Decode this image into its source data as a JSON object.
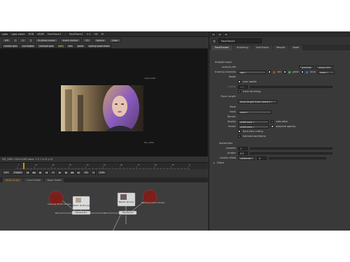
{
  "viewer": {
    "menubar": [
      "rgba",
      "rgba.alpha",
      "RGB",
      "sRGB",
      "FaceTrack1",
      "FaceTrack1"
    ],
    "menubar_extra": [
      "1:1",
      "2D",
      "M"
    ],
    "toolbar1": [
      "f/8",
      "1",
      "Surface mask",
      "track radius",
      "13",
      "ignore",
      "clear"
    ],
    "toolbar2_chips": [
      "center geo",
      "curvegeo",
      "remove geo",
      "pin",
      "set",
      "pose",
      "spring pose track"
    ],
    "frame_marks": [
      "1920,1080",
      "HD_1080"
    ],
    "status": "HD_1080 1920x1080  bbox: 0 0 1  x=0 y=0",
    "timeline_labels": [
      "1",
      "10",
      "20",
      "30",
      "40",
      "50",
      "60",
      "70",
      "80",
      "90",
      "100"
    ],
    "transport": {
      "fps": "24*",
      "mode": "Global",
      "frame": "1",
      "step": "10",
      "end": "100"
    }
  },
  "dag": {
    "tabs": [
      "Node Graph",
      "Curve Editor",
      "Dope Sheet"
    ],
    "nodes": {
      "camera1": "Camera1 Photo Camera",
      "read1": "Read1 photo1.jpg",
      "read2": "Read2 clip.mov",
      "camera2": "Camera2 Video Camera",
      "facetrack_a": "FaceSolver1",
      "facetrack_b": "FaceTrack1",
      "viewer": "Viewer1"
    }
  },
  "properties": {
    "title_icons": [
      "lock",
      "clear",
      "close"
    ],
    "node_name": "FaceTrack1",
    "tabs": [
      "FaceTracker",
      "Unlocking",
      "UserTracks",
      "Results",
      "Node"
    ],
    "rows": [
      {
        "label": "",
        "text": "Analysis Input"
      },
      {
        "label": "analysis file",
        "buttons": [
          "preview",
          "show info"
        ]
      },
      {
        "label": "tracking channels",
        "dropdown": "rgb",
        "checks": [
          "red",
          "green",
          "blue"
        ],
        "extra": "luma"
      },
      {
        "label": "Model"
      },
      {
        "label": "",
        "check": "auto reptile"
      },
      {
        "label": "rigidity",
        "value": "0.6"
      },
      {
        "label": "",
        "check": "track trimming"
      },
      {
        "label": "Focal Length"
      },
      {
        "label": "",
        "dropdown": "focal length from camera"
      },
      {
        "label": "Mask"
      },
      {
        "label": "mask",
        "dropdown": "none"
      },
      {
        "label": "Render"
      },
      {
        "label": "display",
        "dropdown": "wireframe",
        "check": "saturation"
      },
      {
        "label": "render",
        "dropdown": "wireframe",
        "check": "adaptive opacity"
      },
      {
        "label": "",
        "check": "back-face culling"
      },
      {
        "label": "",
        "check": "textured wireframe"
      },
      {
        "label": "",
        "text": "motion blur"
      },
      {
        "label": "samples",
        "value": "1"
      },
      {
        "label": "shutter",
        "value": "0.5"
      },
      {
        "label": "shutter offset",
        "dropdown": "centered",
        "value": "0"
      },
      {
        "label": "",
        "text": "Colors"
      }
    ]
  },
  "colors": {
    "accent": "#e08a18",
    "camera_node": "#7b1f1c",
    "viewer_node": "#e8a23c"
  }
}
